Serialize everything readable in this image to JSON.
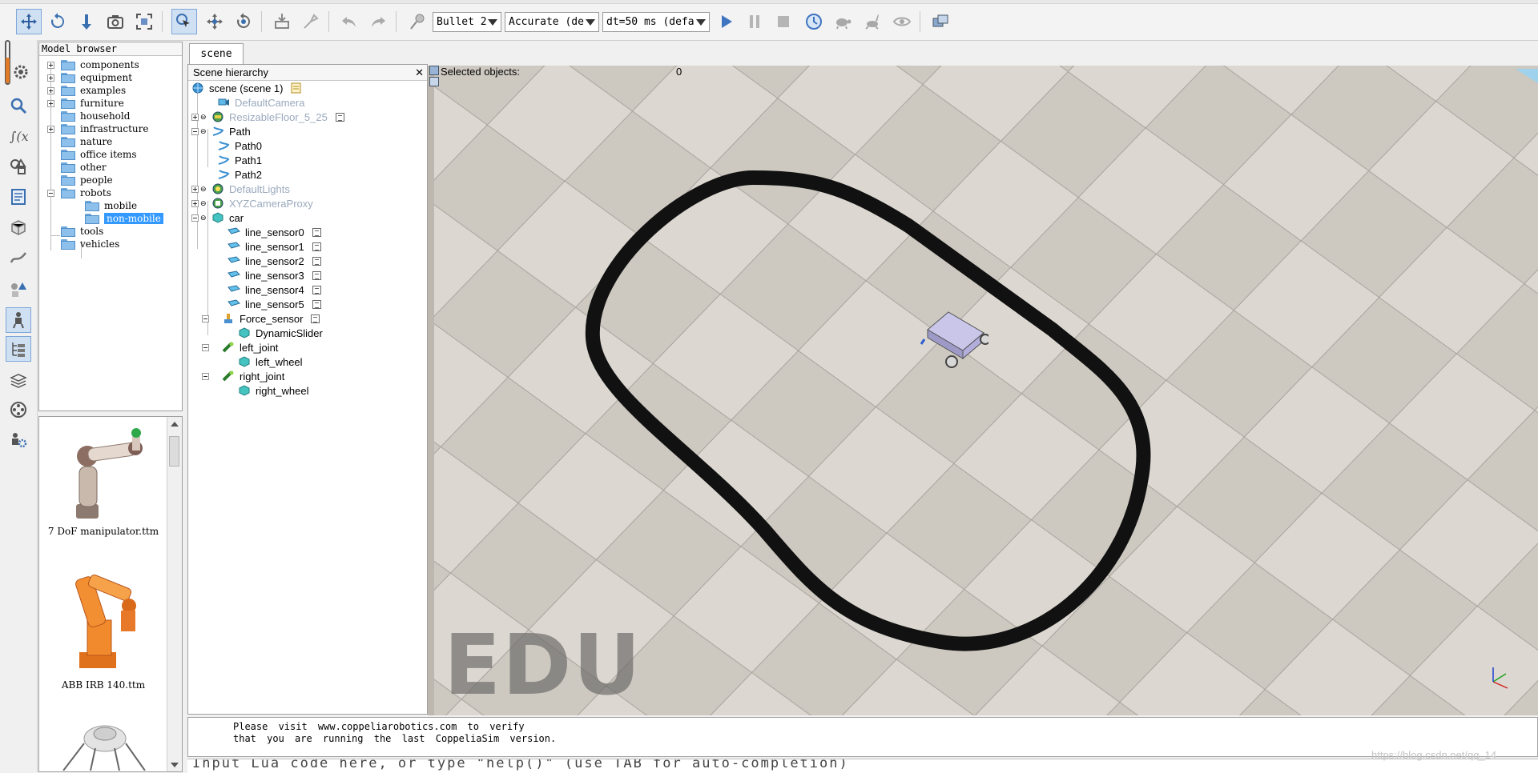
{
  "toolbar": {
    "engine": "Bullet 2",
    "accuracy": "Accurate (de",
    "timestep": "dt=50 ms (defa"
  },
  "model_browser": {
    "title": "Model browser",
    "items": [
      {
        "label": "components",
        "expandable": true
      },
      {
        "label": "equipment",
        "expandable": true
      },
      {
        "label": "examples",
        "expandable": true
      },
      {
        "label": "furniture",
        "expandable": true
      },
      {
        "label": "household",
        "expandable": false
      },
      {
        "label": "infrastructure",
        "expandable": true
      },
      {
        "label": "nature",
        "expandable": false
      },
      {
        "label": "office items",
        "expandable": false
      },
      {
        "label": "other",
        "expandable": false
      },
      {
        "label": "people",
        "expandable": false
      },
      {
        "label": "robots",
        "expandable": true,
        "expanded": true
      },
      {
        "label": "mobile",
        "child": true
      },
      {
        "label": "non-mobile",
        "child": true,
        "selected": true
      },
      {
        "label": "tools",
        "expandable": false
      },
      {
        "label": "vehicles",
        "expandable": false
      }
    ]
  },
  "model_preview": {
    "thumbnails": [
      {
        "label": "7 DoF manipulator.ttm"
      },
      {
        "label": "ABB IRB 140.ttm"
      }
    ]
  },
  "scene_tab": {
    "label": "scene"
  },
  "hierarchy": {
    "title": "Scene hierarchy",
    "close_glyph": "✕",
    "items": [
      {
        "label": "scene (scene 1)",
        "icon": "globe-icon",
        "depth": 0
      },
      {
        "label": "DefaultCamera",
        "icon": "camera-icon",
        "depth": 1,
        "dim": true
      },
      {
        "label": "ResizableFloor_5_25",
        "icon": "floor-icon",
        "depth": 1,
        "dim": true
      },
      {
        "label": "Path",
        "icon": "path-icon",
        "depth": 1
      },
      {
        "label": "Path0",
        "icon": "path-icon",
        "depth": 2
      },
      {
        "label": "Path1",
        "icon": "path-icon",
        "depth": 2
      },
      {
        "label": "Path2",
        "icon": "path-icon",
        "depth": 2
      },
      {
        "label": "DefaultLights",
        "icon": "light-icon",
        "depth": 1,
        "dim": true
      },
      {
        "label": "XYZCameraProxy",
        "icon": "proxy-icon",
        "depth": 1,
        "dim": true
      },
      {
        "label": "car",
        "icon": "shape-icon",
        "depth": 1
      },
      {
        "label": "line_sensor0",
        "icon": "vision-sensor-icon",
        "depth": 2
      },
      {
        "label": "line_sensor1",
        "icon": "vision-sensor-icon",
        "depth": 2
      },
      {
        "label": "line_sensor2",
        "icon": "vision-sensor-icon",
        "depth": 2
      },
      {
        "label": "line_sensor3",
        "icon": "vision-sensor-icon",
        "depth": 2
      },
      {
        "label": "line_sensor4",
        "icon": "vision-sensor-icon",
        "depth": 2
      },
      {
        "label": "line_sensor5",
        "icon": "vision-sensor-icon",
        "depth": 2
      },
      {
        "label": "Force_sensor",
        "icon": "force-sensor-icon",
        "depth": 2
      },
      {
        "label": "DynamicSlider",
        "icon": "shape-icon",
        "depth": 3
      },
      {
        "label": "left_joint",
        "icon": "joint-icon",
        "depth": 2
      },
      {
        "label": "left_wheel",
        "icon": "shape-icon",
        "depth": 3
      },
      {
        "label": "right_joint",
        "icon": "joint-icon",
        "depth": 2
      },
      {
        "label": "right_wheel",
        "icon": "shape-icon",
        "depth": 3
      }
    ]
  },
  "viewport": {
    "selected_label": "Selected objects:",
    "selected_count": "0",
    "watermark": "EDU"
  },
  "console": {
    "line1": "Please  visit  www.coppeliarobotics.com  to  verify",
    "line2": "that  you  are  running  the  last  CoppeliaSim  version."
  },
  "command_bar": {
    "text": "Input Lua code here, or type \"help()\" (use TAB for auto-completion)"
  },
  "overlay": {
    "watermark_url": "https://blog.csdn.net/qq_14"
  },
  "colors": {
    "selection": "#3399ff",
    "folder": "#8ec0ec",
    "track": "#111111",
    "floor_light": "#d9d5ce",
    "floor_dark": "#bfb9b1"
  }
}
